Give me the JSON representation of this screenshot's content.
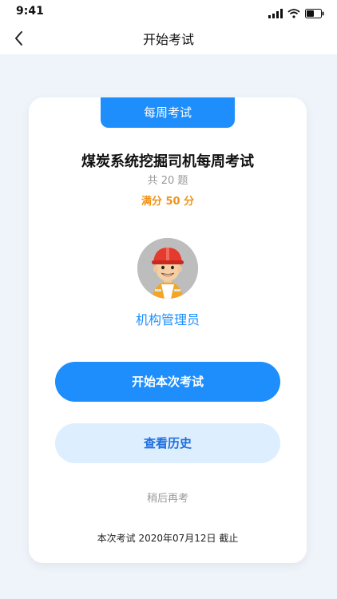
{
  "status": {
    "time": "9:41"
  },
  "nav": {
    "title": "开始考试"
  },
  "card": {
    "tab_label": "每周考试",
    "title": "煤炭系统挖掘司机每周考试",
    "count_text": "共 20 题",
    "score_text": "满分 50 分",
    "org_name": "机构管理员",
    "start_button": "开始本次考试",
    "history_button": "查看历史",
    "later_text": "稍后再考",
    "deadline_text": "本次考试 2020年07月12日 截止"
  },
  "colors": {
    "accent": "#1e8efc",
    "score": "#f0931a",
    "secondary_bg": "#ddeeff",
    "page_bg": "#eef4fa"
  },
  "icons": {
    "back": "chevron-left-icon",
    "signal": "signal-icon",
    "wifi": "wifi-icon",
    "battery": "battery-icon"
  }
}
